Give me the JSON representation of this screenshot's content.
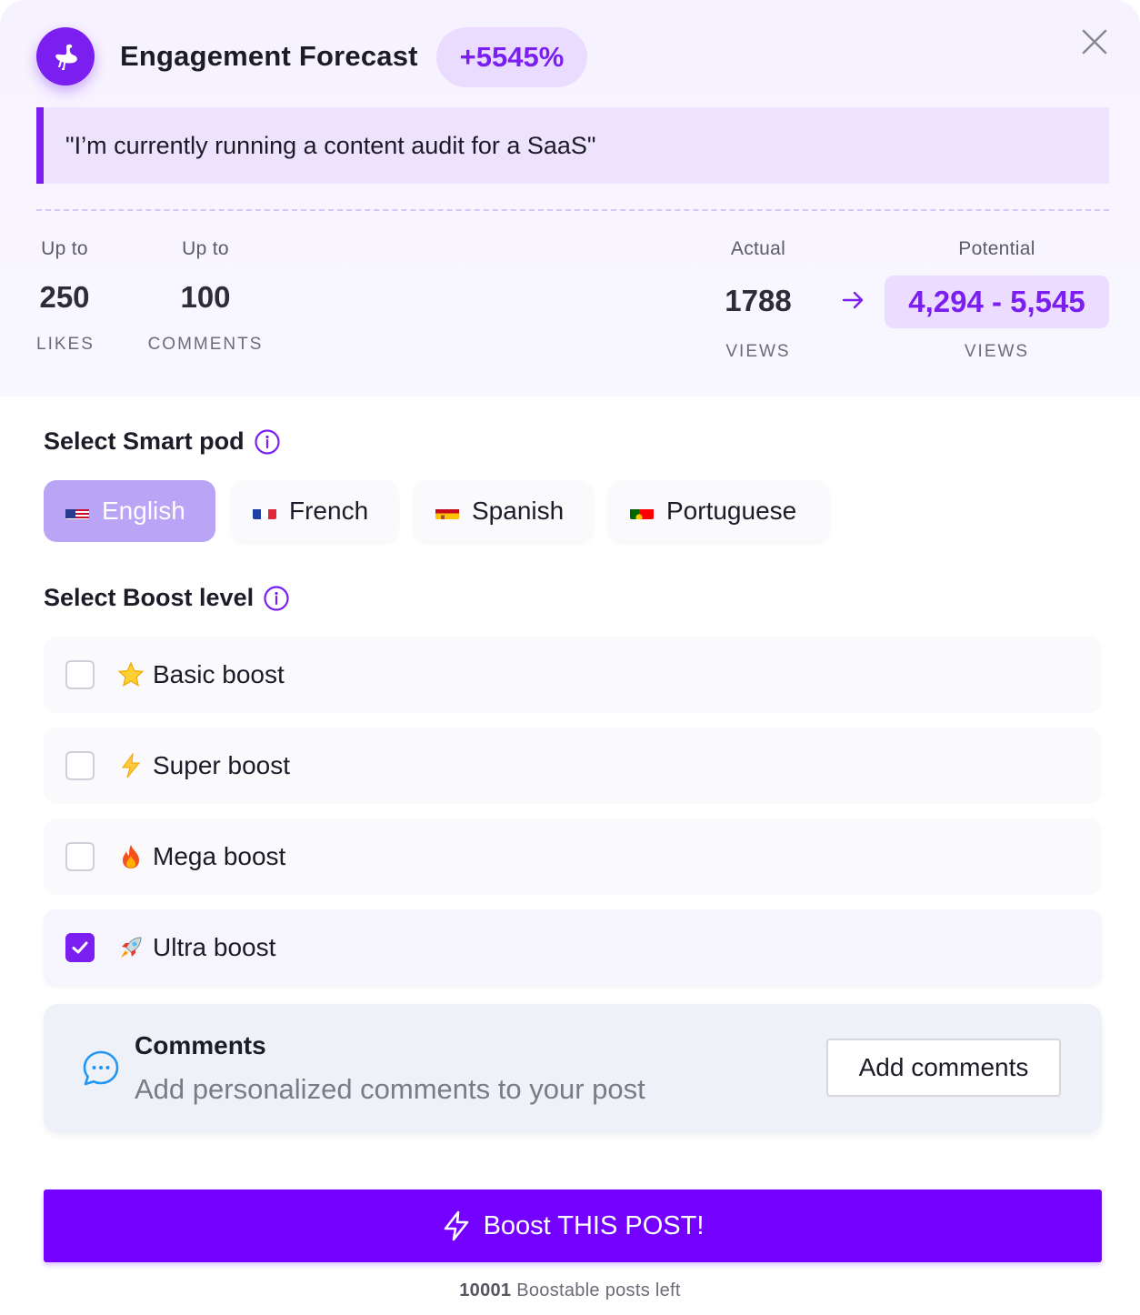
{
  "header": {
    "logo_icon": "ostrich-icon",
    "title": "Engagement Forecast",
    "growth_badge": "+5545%",
    "close_icon": "close-icon"
  },
  "post_quote": "\"I’m currently running a content audit for a SaaS\"",
  "stats": {
    "likes": {
      "label": "Up to",
      "value": "250",
      "unit": "LIKES"
    },
    "comments": {
      "label": "Up to",
      "value": "100",
      "unit": "COMMENTS"
    },
    "actual_views": {
      "label": "Actual",
      "value": "1788",
      "unit": "VIEWS"
    },
    "potential_views": {
      "label": "Potential",
      "value": "4,294 - 5,545",
      "unit": "VIEWS"
    },
    "arrow_icon": "arrow-right-icon"
  },
  "smart_pod": {
    "title": "Select Smart pod",
    "info_icon": "info-icon",
    "selected": "English",
    "options": [
      {
        "label": "English",
        "flag": "us-flag-icon"
      },
      {
        "label": "French",
        "flag": "fr-flag-icon"
      },
      {
        "label": "Spanish",
        "flag": "es-flag-icon"
      },
      {
        "label": "Portuguese",
        "flag": "pt-flag-icon"
      }
    ]
  },
  "boost_level": {
    "title": "Select Boost level",
    "info_icon": "info-icon",
    "options": [
      {
        "label": "Basic boost",
        "icon": "star-icon",
        "checked": false
      },
      {
        "label": "Super boost",
        "icon": "lightning-icon",
        "checked": false
      },
      {
        "label": "Mega boost",
        "icon": "fire-icon",
        "checked": false
      },
      {
        "label": "Ultra boost",
        "icon": "rocket-icon",
        "checked": true
      }
    ]
  },
  "comments_card": {
    "icon": "chat-bubble-icon",
    "title": "Comments",
    "subtitle": "Add personalized comments to your post",
    "button": "Add comments"
  },
  "cta": {
    "icon": "lightning-outline-icon",
    "label": "Boost THIS POST!"
  },
  "footer": {
    "count": "10001",
    "text": "Boostable posts left"
  },
  "colors": {
    "accent": "#7a1ff0",
    "cta": "#7400ff",
    "selected_pill": "#b9a4f6",
    "header_bg": "#f6f2ff",
    "quote_bg": "#ede3fd"
  }
}
